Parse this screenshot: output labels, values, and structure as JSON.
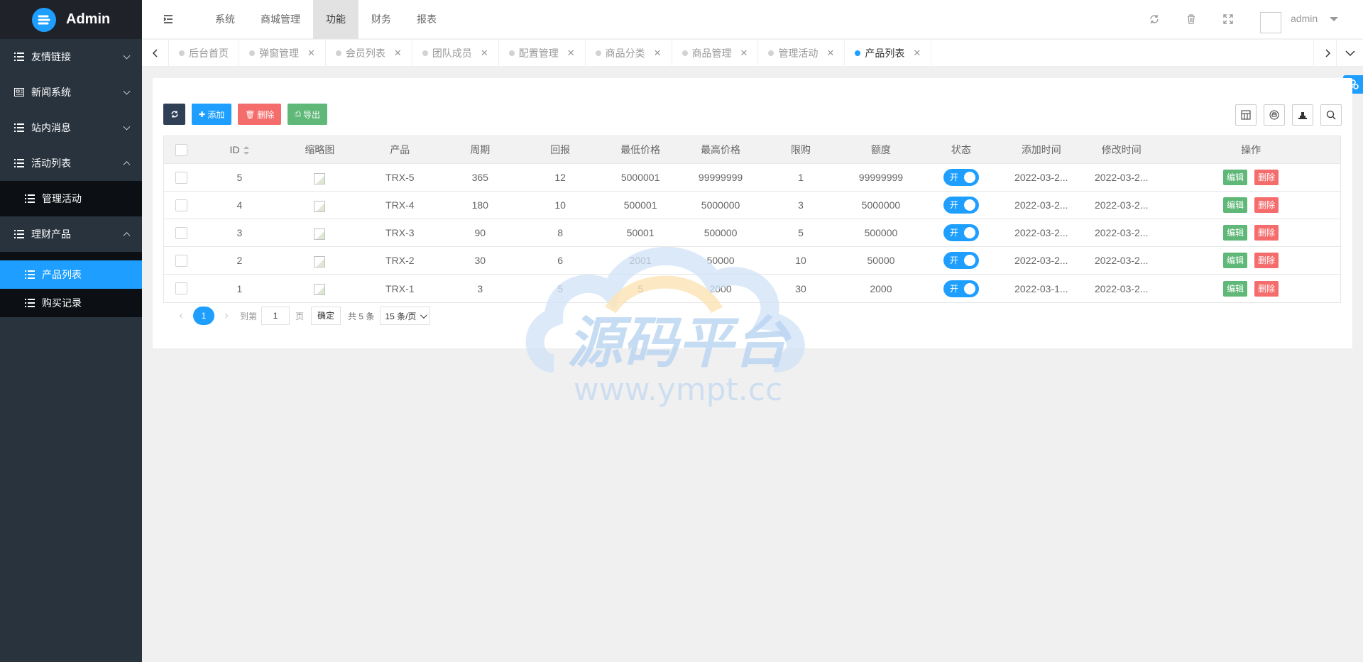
{
  "brand": {
    "name": "Admin"
  },
  "sidebar": {
    "items": [
      {
        "label": "友情链接",
        "expanded": false
      },
      {
        "label": "新闻系统",
        "expanded": false
      },
      {
        "label": "站内消息",
        "expanded": false
      },
      {
        "label": "活动列表",
        "expanded": true,
        "children": [
          {
            "label": "管理活动"
          }
        ]
      },
      {
        "label": "理财产品",
        "expanded": true,
        "children": [
          {
            "label": "产品列表",
            "active": true
          },
          {
            "label": "购买记录"
          }
        ]
      }
    ]
  },
  "topnav": {
    "items": [
      "系统",
      "商城管理",
      "功能",
      "财务",
      "报表"
    ],
    "active": "功能"
  },
  "user": {
    "name": "admin"
  },
  "tabs": [
    {
      "label": "后台首页",
      "closable": false
    },
    {
      "label": "弹窗管理",
      "closable": true
    },
    {
      "label": "会员列表",
      "closable": true
    },
    {
      "label": "团队成员",
      "closable": true
    },
    {
      "label": "配置管理",
      "closable": true
    },
    {
      "label": "商品分类",
      "closable": true
    },
    {
      "label": "商品管理",
      "closable": true
    },
    {
      "label": "管理活动",
      "closable": true
    },
    {
      "label": "产品列表",
      "closable": true,
      "active": true
    }
  ],
  "toolbar": {
    "add": "添加",
    "delete": "删除",
    "export": "导出"
  },
  "table": {
    "headers": {
      "id": "ID",
      "thumb": "缩略图",
      "product": "产品",
      "cycle": "周期",
      "return": "回报",
      "min_price": "最低价格",
      "max_price": "最高价格",
      "limit": "限购",
      "amount": "额度",
      "status": "状态",
      "created": "添加时间",
      "modified": "修改时间",
      "ops": "操作"
    },
    "rows": [
      {
        "id": "5",
        "product": "TRX-5",
        "cycle": "365",
        "return": "12",
        "min_price": "5000001",
        "max_price": "99999999",
        "limit": "1",
        "amount": "99999999",
        "status": "开",
        "created": "2022-03-2...",
        "modified": "2022-03-2..."
      },
      {
        "id": "4",
        "product": "TRX-4",
        "cycle": "180",
        "return": "10",
        "min_price": "500001",
        "max_price": "5000000",
        "limit": "3",
        "amount": "5000000",
        "status": "开",
        "created": "2022-03-2...",
        "modified": "2022-03-2..."
      },
      {
        "id": "3",
        "product": "TRX-3",
        "cycle": "90",
        "return": "8",
        "min_price": "50001",
        "max_price": "500000",
        "limit": "5",
        "amount": "500000",
        "status": "开",
        "created": "2022-03-2...",
        "modified": "2022-03-2..."
      },
      {
        "id": "2",
        "product": "TRX-2",
        "cycle": "30",
        "return": "6",
        "min_price": "2001",
        "max_price": "50000",
        "limit": "10",
        "amount": "50000",
        "status": "开",
        "created": "2022-03-2...",
        "modified": "2022-03-2..."
      },
      {
        "id": "1",
        "product": "TRX-1",
        "cycle": "3",
        "return": "5",
        "min_price": "5",
        "max_price": "2000",
        "limit": "30",
        "amount": "2000",
        "status": "开",
        "created": "2022-03-1...",
        "modified": "2022-03-2..."
      }
    ],
    "row_actions": {
      "edit": "编辑",
      "delete": "删除"
    }
  },
  "pagination": {
    "current": "1",
    "goto_label": "到第",
    "page_input": "1",
    "page_unit": "页",
    "confirm": "确定",
    "total": "共 5 条",
    "per_page": "15 条/页"
  },
  "watermark": {
    "title": "源码平台",
    "url": "www.ympt.cc"
  },
  "colors": {
    "accent": "#1e9fff",
    "sidebar": "#28333e",
    "success": "#5fb878",
    "danger": "#f56c6c"
  }
}
